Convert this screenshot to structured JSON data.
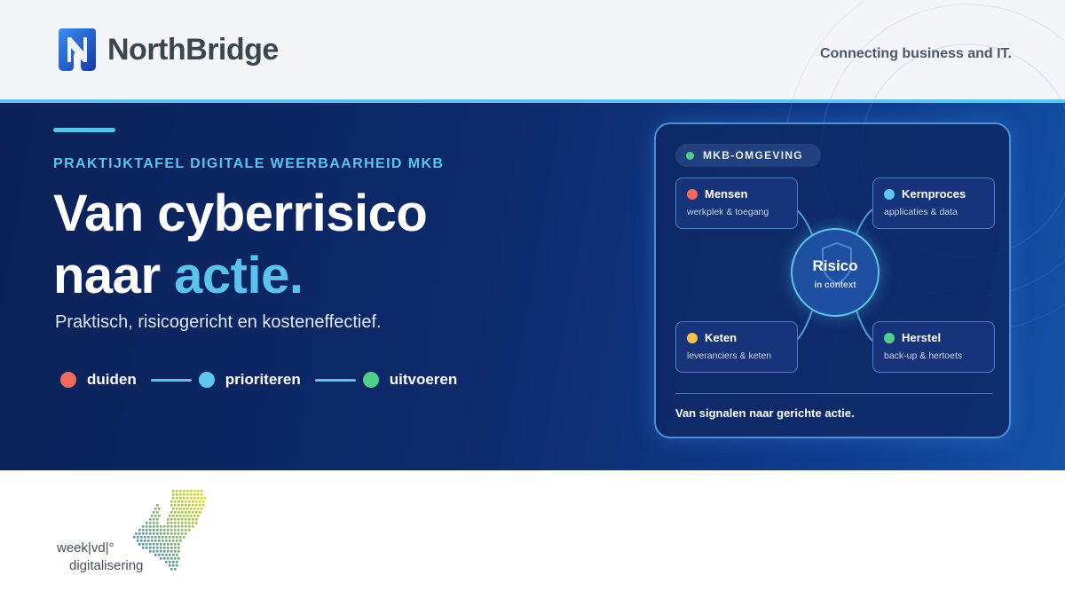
{
  "header": {
    "logo_text": "NorthBridge",
    "tagline": "Connecting business and IT."
  },
  "hero": {
    "kicker": "PRAKTIJKTAFEL DIGITALE WEERBAARHEID MKB",
    "headline_line1": "Van cyberrisico",
    "headline_line2_prefix": "naar ",
    "headline_line2_accent": "actie.",
    "subtitle": "Praktisch, risicogericht en kosteneffectief.",
    "steps": [
      {
        "label": "duiden",
        "color": "#f06b5d"
      },
      {
        "label": "prioriteren",
        "color": "#5cc9f0"
      },
      {
        "label": "uitvoeren",
        "color": "#4fcf87"
      }
    ]
  },
  "panel": {
    "badge": "MKB-OMGEVING",
    "nodes": [
      {
        "name": "Mensen",
        "sub": "werkplek & toegang",
        "color": "#f06b5d"
      },
      {
        "name": "Kernproces",
        "sub": "applicaties & data",
        "color": "#5cc9f0"
      },
      {
        "name": "Keten",
        "sub": "leveranciers & keten",
        "color": "#f2c14e"
      },
      {
        "name": "Herstel",
        "sub": "back-up & hertoets",
        "color": "#4fcf87"
      }
    ],
    "center_title": "Risico",
    "center_sub": "in context",
    "footer": "Van signalen naar gerichte actie."
  },
  "bottom_logo": {
    "line1": "week|vd|°",
    "line2": "digitalisering"
  },
  "colors": {
    "accent": "#5cc3ec",
    "hero_dark": "#0b2158",
    "hero_light": "#1453a6",
    "header_bg": "#f3f5f8",
    "logo_blue": "#1f55c9"
  }
}
